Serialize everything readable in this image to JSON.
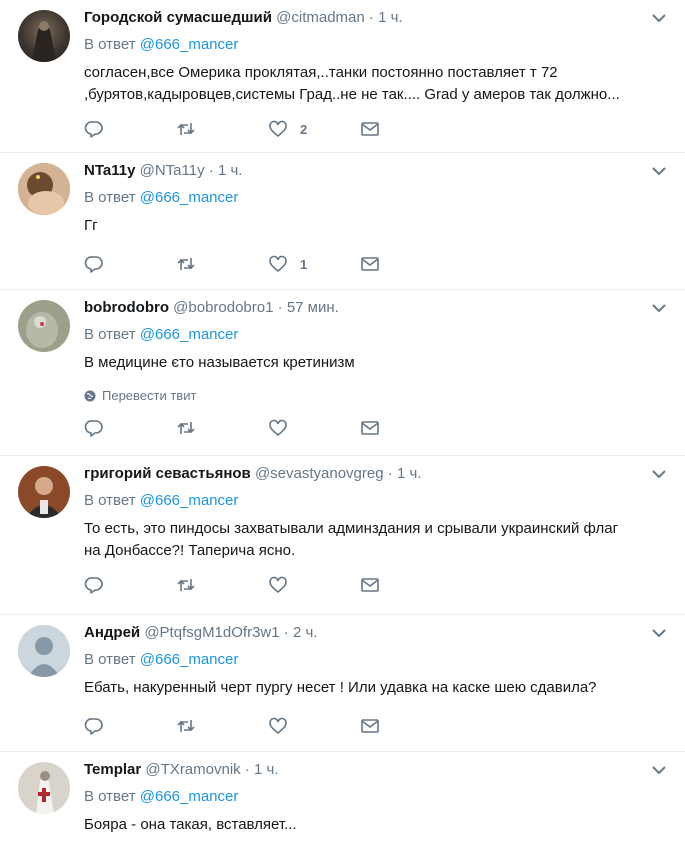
{
  "common": {
    "reply_prefix": "В ответ",
    "reply_handle": "@666_mancer",
    "dot": "·"
  },
  "translate_label": "Перевести твит",
  "tweets": [
    {
      "name": "Городской сумасшедший",
      "handle": "@citmadman",
      "time": "1 ч.",
      "text1": "согласен,все Омерика проклятая,..танки постоянно поставляет т 72",
      "text2": ",бурятов,кадыровцев,системы Град..не не так.... Grad у амеров  так должно...",
      "likes": "2"
    },
    {
      "name": "NTa11y",
      "handle": "@NTa11y",
      "time": "1 ч.",
      "text1": "Гг",
      "likes": "1"
    },
    {
      "name": "bobrodobro",
      "handle": "@bobrodobro1",
      "time": "57 мин.",
      "text1": "В медицине єто называется  кретинизм"
    },
    {
      "name": "григорий севастьянов",
      "handle": "@sevastyanovgreg",
      "time": "1 ч.",
      "text1": "То есть, это пиндосы захватывали админздания и срывали украинский флаг",
      "text2": "на Донбассе?! Таперича ясно."
    },
    {
      "name": "Андрей",
      "handle": "@PtqfsgM1dOfr3w1",
      "time": "2 ч.",
      "text1": "Ебать, накуренный черт пургу несет ! Или удавка на каске шею сдавила?"
    },
    {
      "name": "Templar",
      "handle": "@TXramovnik",
      "time": "1 ч.",
      "text1": "Бояра - она такая, вставляет..."
    }
  ],
  "colors": {
    "text": "#14171a",
    "secondary": "#657786",
    "link": "#1b95e0",
    "divider": "#e6ecf0"
  },
  "icons": [
    "reply-icon",
    "retweet-icon",
    "like-icon",
    "direct-message-icon",
    "chevron-down-icon",
    "globe-icon"
  ]
}
